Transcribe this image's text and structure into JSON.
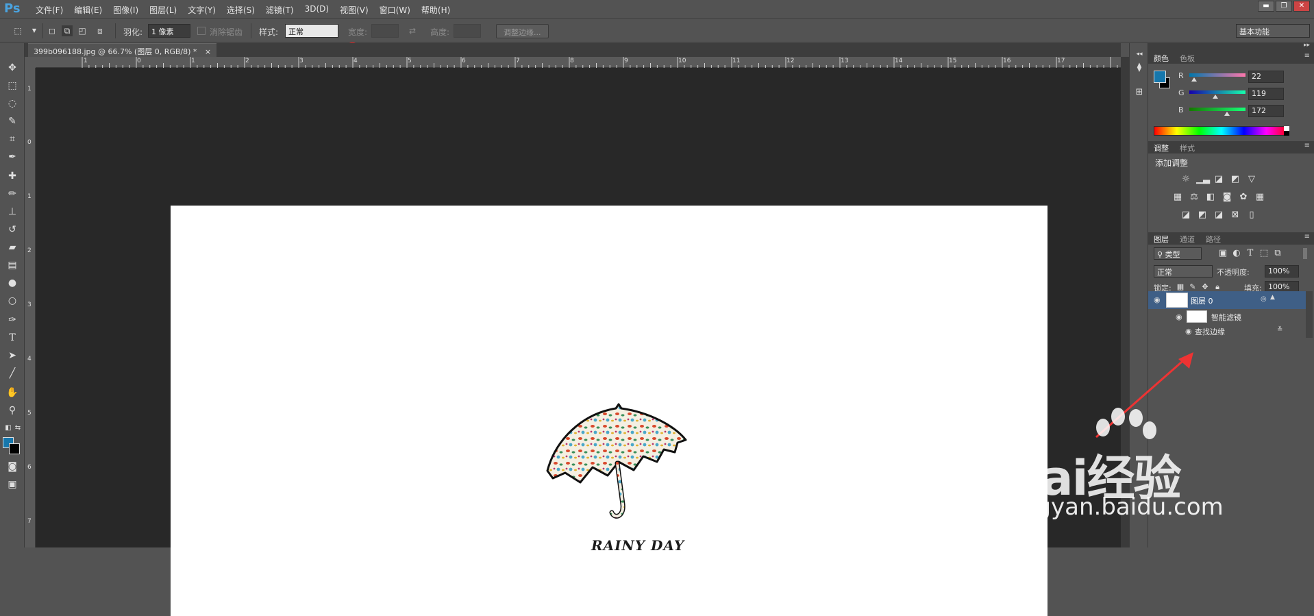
{
  "app": {
    "logo": "Ps",
    "menu": [
      "文件(F)",
      "编辑(E)",
      "图像(I)",
      "图层(L)",
      "文字(Y)",
      "选择(S)",
      "滤镜(T)",
      "3D(D)",
      "视图(V)",
      "窗口(W)",
      "帮助(H)"
    ],
    "accent_color": "#4aa3df"
  },
  "options": {
    "feather_label": "羽化:",
    "feather_value": "1 像素",
    "antialias_label": "消除锯齿",
    "style_label": "样式:",
    "style_value": "正常",
    "width_label": "宽度:",
    "height_label": "高度:",
    "refine_edge_button": "调整边缘...",
    "workspace": "基本功能"
  },
  "document": {
    "tab_title": "399b096188.jpg @ 66.7% (图层 0, RGB/8) *",
    "close_glyph": "×",
    "canvas_text": "RAINY DAY",
    "ruler_h": [
      "1",
      "0",
      "1",
      "2",
      "3",
      "4",
      "5",
      "6",
      "7",
      "8",
      "9",
      "10",
      "11",
      "12",
      "13",
      "14",
      "15",
      "16",
      "17"
    ],
    "ruler_v": [
      "1",
      "0",
      "1",
      "2",
      "3",
      "4",
      "5",
      "6",
      "7"
    ]
  },
  "color_panel": {
    "tabs": [
      "颜色",
      "色板"
    ],
    "foreground_color": "#1677ac",
    "background_color": "#000000",
    "r_label": "R",
    "g_label": "G",
    "b_label": "B",
    "r": "22",
    "g": "119",
    "b": "172",
    "r_fraction": 0.086,
    "g_fraction": 0.467,
    "b_fraction": 0.675
  },
  "adjustments_panel": {
    "tabs": [
      "调整",
      "样式"
    ],
    "add_label": "添加调整"
  },
  "layers_panel": {
    "tabs": [
      "图层",
      "通道",
      "路径"
    ],
    "filter_type": "类型",
    "blend_mode": "正常",
    "opacity_label": "不透明度:",
    "opacity_value": "100%",
    "lock_label": "锁定:",
    "fill_label": "填充:",
    "fill_value": "100%",
    "layers": [
      {
        "name": "图层 0"
      },
      {
        "name": "智能滤镜"
      },
      {
        "name": "查找边缘"
      }
    ]
  },
  "watermark": {
    "brand": "Bai经验",
    "url": "jingyan.baidu.com"
  }
}
